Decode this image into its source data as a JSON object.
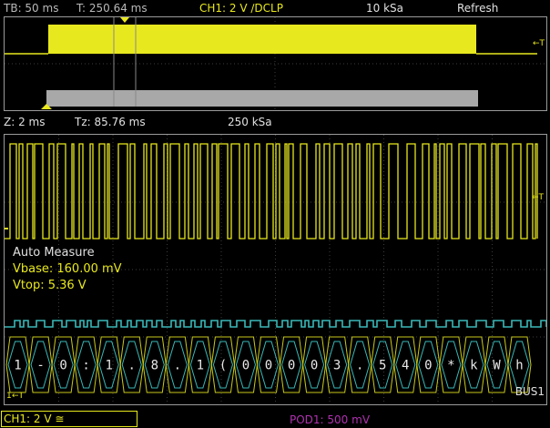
{
  "header": {
    "timebase": "TB: 50 ms",
    "trigger_time": "T: 250.64 ms",
    "channel_setting": "CH1: 2 V ∕DCLP",
    "sample_rate": "10 kSa",
    "refresh_label": "Refresh"
  },
  "zoom_info": {
    "zoom": "Z: 2 ms",
    "zoom_time": "Tz: 85.76 ms",
    "zoom_sample_rate": "250 kSa"
  },
  "measure": {
    "title": "Auto Measure",
    "vbase": "Vbase: 160.00 mV",
    "vtop": "Vtop: 5.36 V"
  },
  "bus": {
    "label": "BUS1",
    "symbols": [
      "1",
      "-",
      "0",
      ":",
      "1",
      ".",
      "8",
      ".",
      "1",
      "(",
      "0",
      "0",
      "0",
      "0",
      "3",
      ".",
      "5",
      "4",
      "0",
      "*",
      "k",
      "W",
      "h"
    ]
  },
  "markers": {
    "trigger_level_overview": "←T",
    "trigger_level_zoom": "←T",
    "trigger_level_bus": "←T",
    "channel_marker_bus": "1"
  },
  "footer": {
    "ch1": "CH1: 2 V ≅",
    "pod1": "POD1: 500 mV"
  },
  "colors": {
    "ch1": "#e8e81f",
    "bus": "#3ab8b8",
    "pod": "#b030b0",
    "grid": "#3c3c3c",
    "window": "#9a9a9a"
  }
}
